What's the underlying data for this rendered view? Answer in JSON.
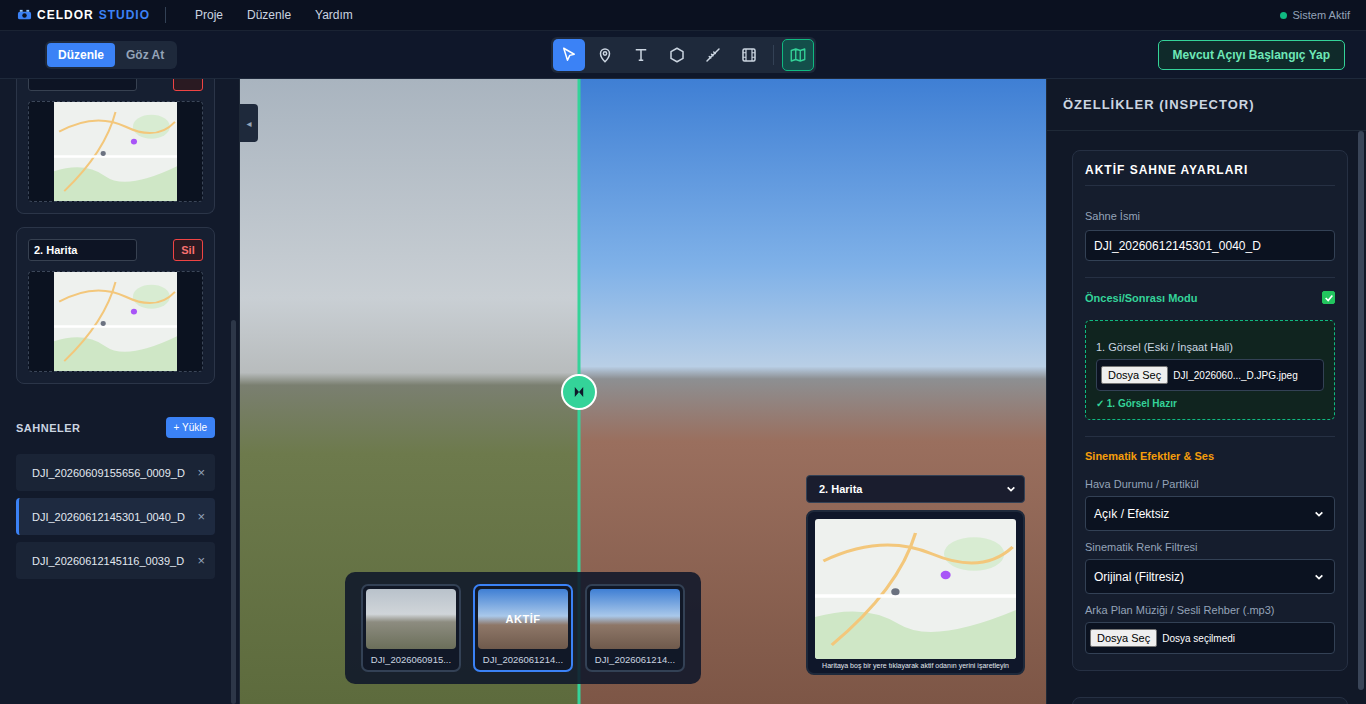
{
  "app": {
    "brand": "CELDOR",
    "brand_accent": "STUDIO",
    "menu": [
      "Proje",
      "Düzenle",
      "Yardım"
    ],
    "status": "Sistem Aktif",
    "status_on": true
  },
  "modes": [
    {
      "label": "Düzenle",
      "selected": true
    },
    {
      "label": "Göz At",
      "selected": false
    }
  ],
  "tools": [
    {
      "selected": true
    },
    {
      "selected": false
    },
    {
      "selected": false
    },
    {
      "selected": false
    },
    {
      "selected": false
    },
    {
      "selected": false
    }
  ],
  "map_toggle": {
    "on": true
  },
  "start_button": "Mevcut Açıyı Başlangıç Yap",
  "sidebar": {
    "collapse": "◂",
    "maps": [
      {
        "clipped": true
      },
      {
        "clipped": false,
        "name": "2. Harita",
        "delete": "Sil"
      }
    ],
    "scenes_title": "SAHNELER",
    "upload": "+ Yükle",
    "scenes": [
      {
        "name": "DJI_20260609155656_0009_D",
        "selected": false,
        "remove": "×"
      },
      {
        "name": "DJI_20260612145301_0040_D",
        "selected": true,
        "remove": "×"
      },
      {
        "name": "DJI_20260612145116_0039_D",
        "selected": false,
        "remove": "×"
      }
    ]
  },
  "viewer": {
    "compare": {
      "level": 0.42
    },
    "active_badge": "AKTİF",
    "thumbnails": [
      {
        "label": "DJI_2026060915...",
        "selected": false
      },
      {
        "label": "DJI_2026061214...",
        "selected": true
      },
      {
        "label": "DJI_2026061214...",
        "selected": false
      }
    ],
    "map_panel": {
      "selected": "2. Harita",
      "caption": "Haritaya boş bir yere tıklayarak aktif odanın yerini işaretleyin"
    }
  },
  "inspector": {
    "title": "ÖZELLİKLER (INSPECTOR)",
    "card_title": "AKTİF SAHNE AYARLARI",
    "scene_name_label": "Sahne İsmi",
    "scene_name": "DJI_20260612145301_0040_D",
    "compare_label": "Öncesi/Sonrası Modu",
    "compare_checked": true,
    "image_label": "1. Görsel (Eski / İnşaat Hali)",
    "file_button": "Dosya Seç",
    "image_file": "DJI_2026060..._D.JPG.jpeg",
    "image_ready": "✓ 1. Görsel Hazır",
    "effects_title": "Sinematik Efektler & Ses",
    "weather_label": "Hava Durumu / Partikül",
    "weather_value": "Açık / Efektsiz",
    "filter_label": "Sinematik Renk Filtresi",
    "filter_value": "Orijinal (Filtresiz)",
    "music_label": "Arka Plan Müziği / Sesli Rehber (.mp3)",
    "music_file": "Dosya seçilmedi"
  }
}
